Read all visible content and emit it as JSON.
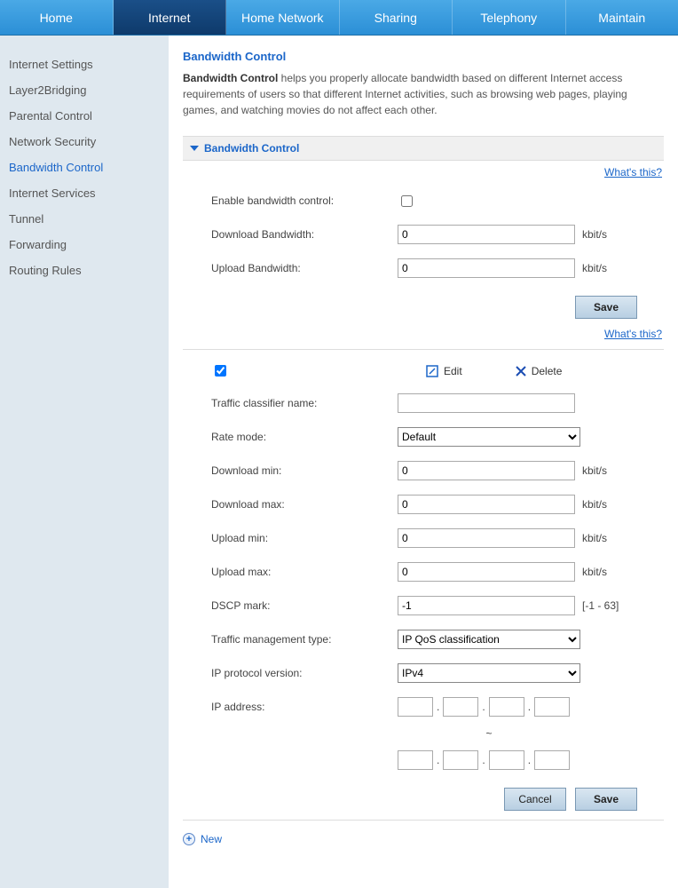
{
  "topnav": {
    "items": [
      {
        "label": "Home"
      },
      {
        "label": "Internet",
        "active": true
      },
      {
        "label": "Home Network"
      },
      {
        "label": "Sharing"
      },
      {
        "label": "Telephony"
      },
      {
        "label": "Maintain"
      }
    ]
  },
  "sidebar": {
    "items": [
      {
        "label": "Internet Settings"
      },
      {
        "label": "Layer2Bridging"
      },
      {
        "label": "Parental Control"
      },
      {
        "label": "Network Security"
      },
      {
        "label": "Bandwidth Control",
        "active": true
      },
      {
        "label": "Internet Services"
      },
      {
        "label": "Tunnel"
      },
      {
        "label": "Forwarding"
      },
      {
        "label": "Routing Rules"
      }
    ]
  },
  "page": {
    "title": "Bandwidth Control",
    "desc_bold": "Bandwidth Control",
    "desc_rest": " helps you properly allocate bandwidth based on different Internet access requirements of users so that different Internet activities, such as browsing web pages, playing games, and watching movies do not affect each other.",
    "whats": "What's this?"
  },
  "section1": {
    "title": "Bandwidth Control",
    "enable_label": "Enable bandwidth control:",
    "download_label": "Download Bandwidth:",
    "download_value": "0",
    "upload_label": "Upload Bandwidth:",
    "upload_value": "0",
    "unit": "kbit/s",
    "save": "Save"
  },
  "actions": {
    "edit": "Edit",
    "delete": "Delete"
  },
  "rule": {
    "name_label": "Traffic classifier name:",
    "name_value": "",
    "rate_mode_label": "Rate mode:",
    "rate_mode_value": "Default",
    "dl_min_label": "Download min:",
    "dl_min_value": "0",
    "dl_max_label": "Download max:",
    "dl_max_value": "0",
    "ul_min_label": "Upload min:",
    "ul_min_value": "0",
    "ul_max_label": "Upload max:",
    "ul_max_value": "0",
    "dscp_label": "DSCP mark:",
    "dscp_value": "-1",
    "dscp_hint": "[-1 - 63]",
    "mgmt_label": "Traffic management type:",
    "mgmt_value": "IP QoS classification",
    "ipver_label": "IP protocol version:",
    "ipver_value": "IPv4",
    "ipaddr_label": "IP address:",
    "tilde": "~",
    "unit": "kbit/s",
    "cancel": "Cancel",
    "save": "Save"
  },
  "new_label": "New"
}
